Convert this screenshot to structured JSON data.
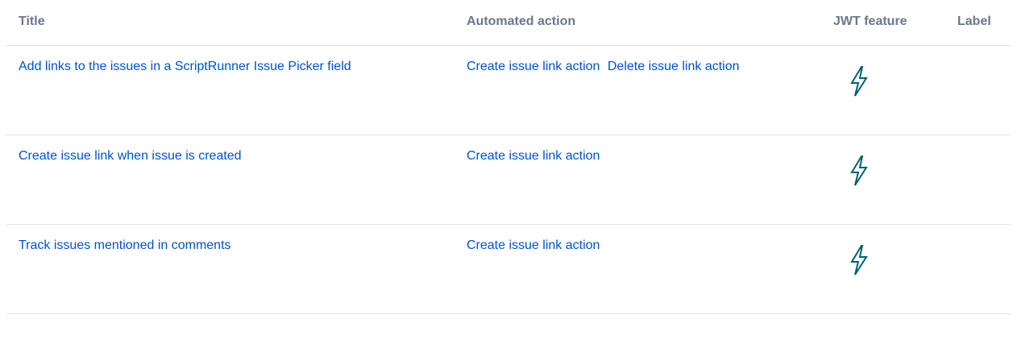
{
  "columns": {
    "title": "Title",
    "action": "Automated action",
    "feature": "JWT feature",
    "label": "Label"
  },
  "rows": [
    {
      "title": "Add links to the issues in a ScriptRunner Issue Picker field",
      "actions": [
        "Create issue link action",
        "Delete issue link action"
      ],
      "feature_icon": "lightning-bolt-icon",
      "label": ""
    },
    {
      "title": "Create issue link when issue is created",
      "actions": [
        "Create issue link action"
      ],
      "feature_icon": "lightning-bolt-icon",
      "label": ""
    },
    {
      "title": "Track issues mentioned in comments",
      "actions": [
        "Create issue link action"
      ],
      "feature_icon": "lightning-bolt-icon",
      "label": ""
    }
  ],
  "colors": {
    "link": "#0052cc",
    "header_text": "#6b778c",
    "divider": "#dfe1e6",
    "icon_stroke": "#00606b"
  }
}
